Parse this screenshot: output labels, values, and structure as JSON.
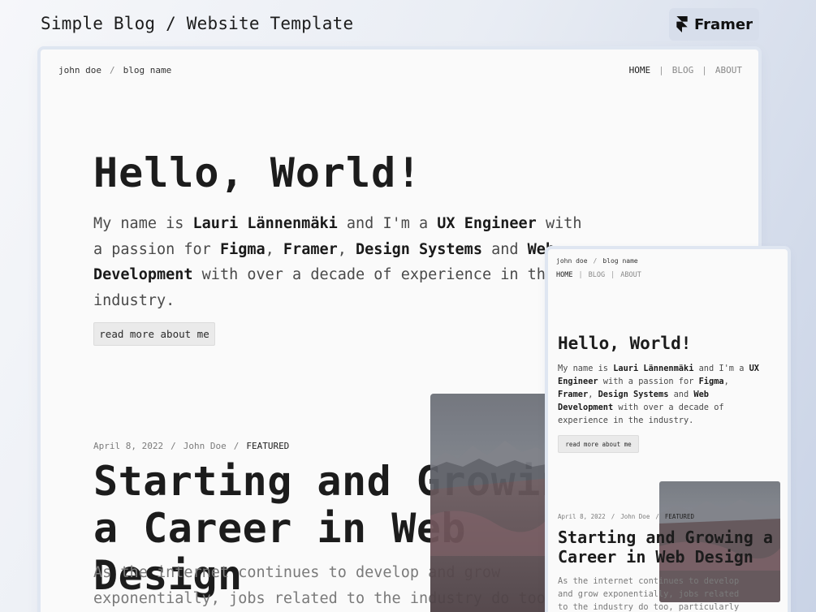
{
  "header": {
    "title": "Simple Blog / Website Template",
    "brand": "Framer"
  },
  "desktop": {
    "nav": {
      "author": "john doe",
      "separator": "/",
      "blog_name": "blog name",
      "links": [
        "HOME",
        "BLOG",
        "ABOUT"
      ],
      "active": "HOME",
      "link_separator": "|"
    },
    "hero": {
      "title": "Hello, World!",
      "intro_1": "My name is ",
      "name": "Lauri Lännenmäki",
      "intro_2": " and I'm a ",
      "role": "UX Engineer",
      "intro_3": " with a passion for ",
      "skill_1": "Figma",
      "comma_1": ", ",
      "skill_2": "Framer",
      "comma_2": ", ",
      "skill_3": "Design Systems",
      "and": " and ",
      "skill_4": "Web Development",
      "intro_4": " with over a decade of experience in the industry.",
      "button": "read more about me"
    },
    "post": {
      "date": "April 8, 2022",
      "author": "John Doe",
      "tag": "FEATURED",
      "title": "Starting and Growing a Career in Web Design",
      "excerpt": "As the internet continues to develop and grow exponentially, jobs related to the industry do too,"
    }
  },
  "mobile": {
    "nav": {
      "author": "john doe",
      "blog_name": "blog name",
      "links": [
        "HOME",
        "BLOG",
        "ABOUT"
      ]
    },
    "hero": {
      "title": "Hello, World!",
      "button": "read more about me"
    },
    "post": {
      "date": "April 8, 2022",
      "author": "John Doe",
      "tag": "FEATURED",
      "title": "Starting and Growing a Career in Web Design",
      "excerpt": "As the internet continues to develop and grow exponentially, jobs related to the industry do too, particularly"
    }
  },
  "colors": {
    "background": "#e9edf4",
    "frame": "#fafafa",
    "text": "#1d1d1d",
    "muted": "#7a7a7a",
    "button_bg": "#eaeaea"
  }
}
